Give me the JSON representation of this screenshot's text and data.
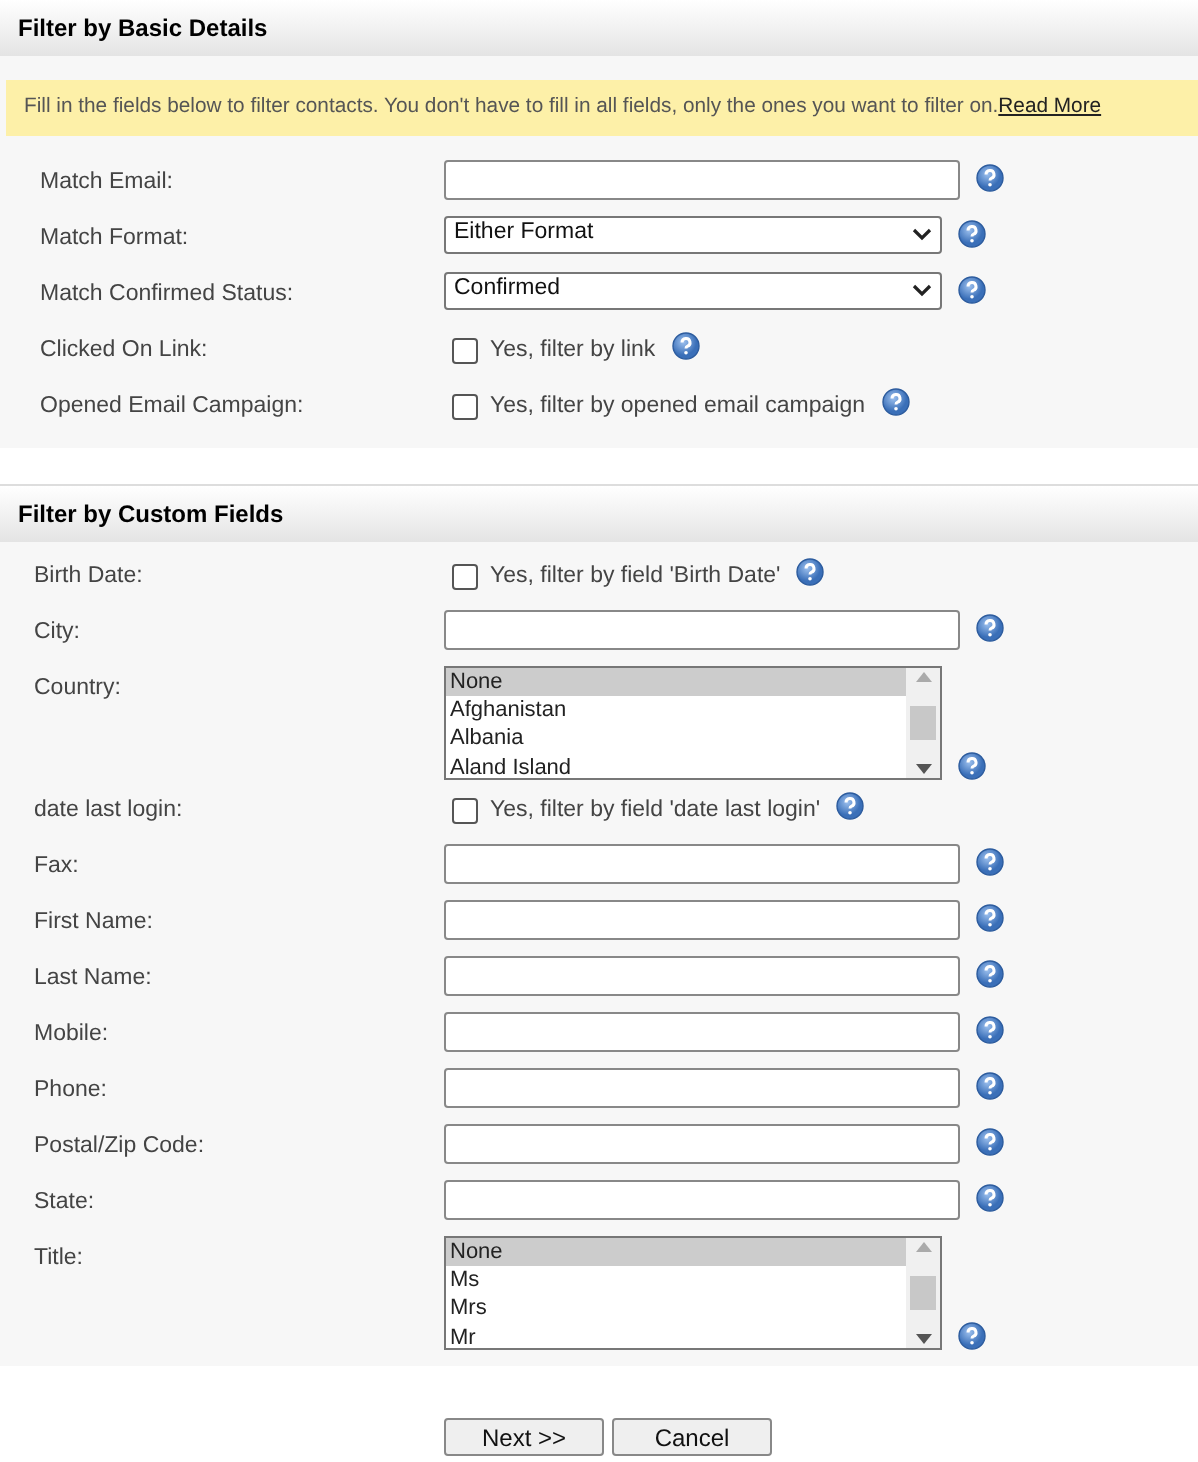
{
  "sections": [
    {
      "title": "Filter by Basic Details",
      "notice": {
        "text": "Fill in the fields below to filter contacts. You don't have to fill in all fields, only the ones you want to filter on.",
        "link": "Read More"
      },
      "fields": [
        {
          "kind": "text",
          "label": "Match Email:"
        },
        {
          "kind": "select",
          "label": "Match Format:",
          "value": "Either Format"
        },
        {
          "kind": "select",
          "label": "Match Confirmed Status:",
          "value": "Confirmed"
        },
        {
          "kind": "checkbox",
          "label": "Clicked On Link:",
          "option": "Yes, filter by link",
          "checked": false
        },
        {
          "kind": "checkbox",
          "label": "Opened Email Campaign:",
          "option": "Yes, filter by opened email campaign",
          "checked": false
        }
      ]
    },
    {
      "title": "Filter by Custom Fields",
      "fields": [
        {
          "kind": "checkbox",
          "label": "Birth Date:",
          "option": "Yes, filter by field 'Birth Date'",
          "checked": false
        },
        {
          "kind": "text",
          "label": "City:"
        },
        {
          "kind": "listbox",
          "label": "Country:",
          "options": [
            {
              "text": "None",
              "selected": true
            },
            {
              "text": "Afghanistan",
              "selected": false
            },
            {
              "text": "Albania",
              "selected": false
            },
            {
              "text": "Aland Island",
              "selected": false
            }
          ]
        },
        {
          "kind": "checkbox",
          "label": "date last login:",
          "option": "Yes, filter by field 'date last login'",
          "checked": false
        },
        {
          "kind": "text",
          "label": "Fax:"
        },
        {
          "kind": "text",
          "label": "First Name:"
        },
        {
          "kind": "text",
          "label": "Last Name:"
        },
        {
          "kind": "text",
          "label": "Mobile:"
        },
        {
          "kind": "text",
          "label": "Phone:"
        },
        {
          "kind": "text",
          "label": "Postal/Zip Code:"
        },
        {
          "kind": "text",
          "label": "State:"
        },
        {
          "kind": "listbox",
          "label": "Title:",
          "options": [
            {
              "text": "None",
              "selected": true
            },
            {
              "text": "Ms",
              "selected": false
            },
            {
              "text": "Mrs",
              "selected": false
            },
            {
              "text": "Mr",
              "selected": false
            }
          ]
        }
      ]
    }
  ],
  "buttons": [
    "Next >>",
    "Cancel"
  ]
}
